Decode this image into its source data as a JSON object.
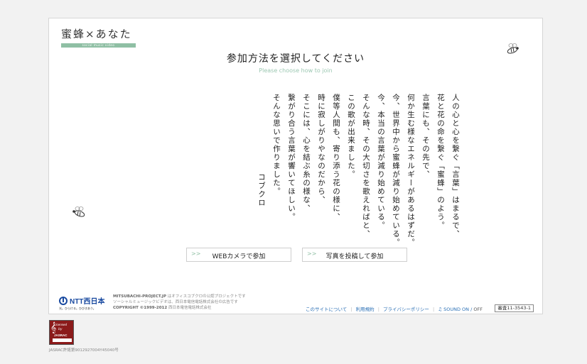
{
  "logo": {
    "text": "蜜蜂×あなた",
    "tagline": "social music video"
  },
  "header": {
    "title": "参加方法を選択してください",
    "subtitle": "Please choose how to join"
  },
  "poem": {
    "lines": [
      "人の心と心を繋ぐ「言葉」はまるで、",
      "花と花の命を繋ぐ「蜜蜂」のよう。",
      "言葉にも、その先で、",
      "何か生む様なエネルギーがあるはずだ。",
      "今、世界中から蜜蜂が減り始めている。",
      "今、本当の言葉が減り始めている。",
      "そんな時、その大切さを歌えればと、",
      "この歌が出来ました。",
      "僕等人間も、寄り添う花の様に、",
      "時に寂しがりやなのだから、",
      "そこには、心を結ぶ糸の様な、",
      "繋がり合う言葉が響いてほしい。",
      "そんな思いで作りました。"
    ],
    "author": "コブクロ"
  },
  "buttons": {
    "webcam": {
      "arrow": ">>",
      "label": "WEBカメラで参加"
    },
    "photo": {
      "arrow": ">>",
      "label": "写真を投稿して参加"
    }
  },
  "company": {
    "name": "NTT西日本",
    "tagline": "光。ひらける。ひびきあう。",
    "info_line1_bold": "MITSUBACHI-PROJECT.JP",
    "info_line1_rest": " はオフィスコブクロの公認プロジェクトです",
    "info_line2": "ソーシャルミュージックビデオは、西日本電信電話株式会社の広告です",
    "copyright": "COPYRIGHT ©1999-2012",
    "copyright_owner": " 西日本電信電話株式会社"
  },
  "footer": {
    "links": [
      "このサイトについて",
      "利用規約",
      "プライバシーポリシー"
    ],
    "sound_label": "♫ SOUND ON",
    "sound_off": "OFF",
    "sound_sep": "/",
    "code": "審査11-3543-1"
  },
  "jasrac": {
    "badge_line1": "Licensed",
    "badge_line2": "by",
    "badge_line3": "JASRAC",
    "license_number": "JASRAC許諾第9012927004Y45040号"
  },
  "colors": {
    "accent_green": "#8fbfa4",
    "link_blue": "#2a6fb5",
    "ntt_blue": "#1a4aa0",
    "jasrac_red": "#8b1a1a"
  }
}
